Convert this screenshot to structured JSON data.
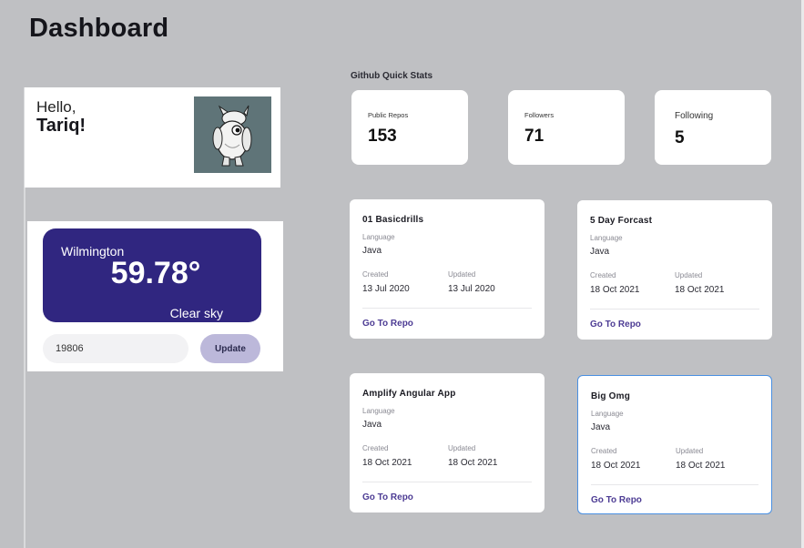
{
  "page": {
    "title": "Dashboard"
  },
  "greeting": {
    "hello": "Hello,",
    "name": "Tariq!"
  },
  "weather": {
    "city": "Wilmington",
    "temperature": "59.78°",
    "description": "Clear sky",
    "zip_value": "19806",
    "update_label": "Update",
    "accent_color": "#302680"
  },
  "github": {
    "heading": "Github Quick Stats",
    "stats": [
      {
        "label": "Public Repos",
        "value": "153"
      },
      {
        "label": "Followers",
        "value": "71"
      },
      {
        "label": "Following",
        "value": "5"
      }
    ]
  },
  "repos": [
    {
      "name": "01 Basicdrills",
      "language_label": "Language",
      "language": "Java",
      "created_label": "Created",
      "created": "13 Jul 2020",
      "updated_label": "Updated",
      "updated": "13 Jul 2020",
      "link": "Go To Repo"
    },
    {
      "name": "5 Day Forcast",
      "language_label": "Language",
      "language": "Java",
      "created_label": "Created",
      "created": "18 Oct 2021",
      "updated_label": "Updated",
      "updated": "18 Oct 2021",
      "link": "Go To Repo"
    },
    {
      "name": "Amplify Angular App",
      "language_label": "Language",
      "language": "Java",
      "created_label": "Created",
      "created": "18 Oct 2021",
      "updated_label": "Updated",
      "updated": "18 Oct 2021",
      "link": "Go To Repo"
    },
    {
      "name": "Big Omg",
      "language_label": "Language",
      "language": "Java",
      "created_label": "Created",
      "created": "18 Oct 2021",
      "updated_label": "Updated",
      "updated": "18 Oct 2021",
      "link": "Go To Repo"
    }
  ]
}
